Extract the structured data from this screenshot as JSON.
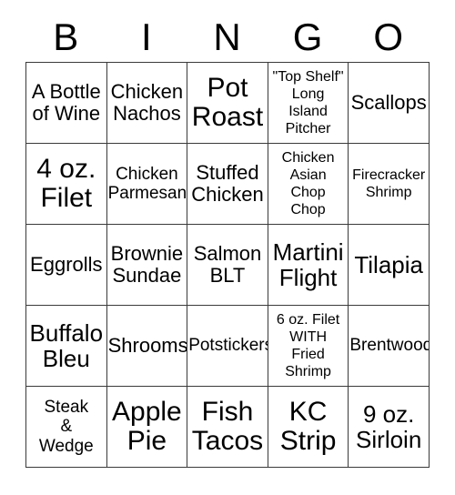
{
  "card": {
    "headers": [
      "B",
      "I",
      "N",
      "G",
      "O"
    ],
    "rows": [
      [
        {
          "text": "A Bottle\nof Wine",
          "size": "fs-l"
        },
        {
          "text": "Chicken\nNachos",
          "size": "fs-l"
        },
        {
          "text": "Pot\nRoast",
          "size": "fs-xxl"
        },
        {
          "text": "\"Top Shelf\"\nLong\nIsland\nPitcher",
          "size": "fs-s"
        },
        {
          "text": "Scallops",
          "size": "fs-l"
        }
      ],
      [
        {
          "text": "4 oz.\nFilet",
          "size": "fs-xxl"
        },
        {
          "text": "Chicken\nParmesan",
          "size": "fs-m"
        },
        {
          "text": "Stuffed\nChicken",
          "size": "fs-l"
        },
        {
          "text": "Chicken\nAsian\nChop\nChop",
          "size": "fs-s"
        },
        {
          "text": "Firecracker\nShrimp",
          "size": "fs-s"
        }
      ],
      [
        {
          "text": "Eggrolls",
          "size": "fs-l"
        },
        {
          "text": "Brownie\nSundae",
          "size": "fs-l"
        },
        {
          "text": "Salmon\nBLT",
          "size": "fs-l"
        },
        {
          "text": "Martini\nFlight",
          "size": "fs-xl"
        },
        {
          "text": "Tilapia",
          "size": "fs-xl"
        }
      ],
      [
        {
          "text": "Buffalo\nBleu",
          "size": "fs-xl"
        },
        {
          "text": "Shrooms",
          "size": "fs-l"
        },
        {
          "text": "Potstickers",
          "size": "fs-m"
        },
        {
          "text": "6 oz. Filet\nWITH\nFried\nShrimp",
          "size": "fs-s"
        },
        {
          "text": "Brentwood",
          "size": "fs-m"
        }
      ],
      [
        {
          "text": "Steak\n&\nWedge",
          "size": "fs-m"
        },
        {
          "text": "Apple\nPie",
          "size": "fs-xxl"
        },
        {
          "text": "Fish\nTacos",
          "size": "fs-xxl"
        },
        {
          "text": "KC\nStrip",
          "size": "fs-xxl"
        },
        {
          "text": "9 oz.\nSirloin",
          "size": "fs-xl"
        }
      ]
    ]
  },
  "colors": {
    "border": "#3a3a3a",
    "cell_background": "#ffffff",
    "text": "#000000",
    "page_background": "#ffffff"
  }
}
